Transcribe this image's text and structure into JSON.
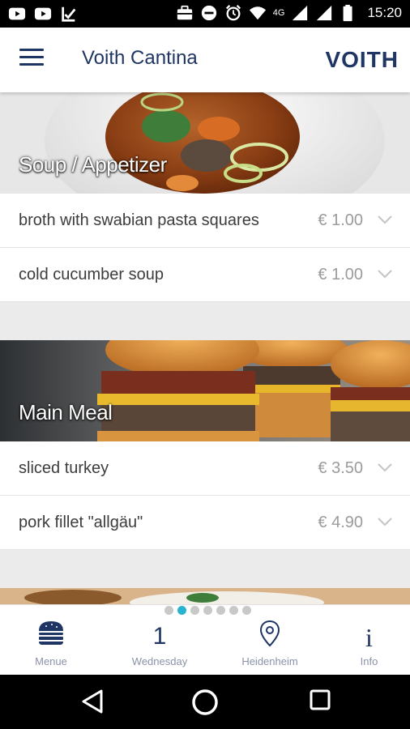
{
  "status_bar": {
    "time": "15:20",
    "network": "4G",
    "left_icons": [
      "youtube-icon",
      "youtube-icon",
      "notification-check-icon"
    ],
    "right_icons": [
      "briefcase-icon",
      "do-not-disturb-icon",
      "alarm-icon",
      "wifi-icon",
      "signal-icon",
      "signal-icon",
      "battery-icon"
    ]
  },
  "app_bar": {
    "title": "Voith Cantina",
    "brand": "VOITH",
    "menu_icon": "hamburger-menu-icon"
  },
  "sections": [
    {
      "title": "Soup / Appetizer",
      "items": [
        {
          "name": "broth with swabian pasta squares",
          "price": "€ 1.00"
        },
        {
          "name": "cold cucumber soup",
          "price": "€ 1.00"
        }
      ]
    },
    {
      "title": "Main Meal",
      "items": [
        {
          "name": "sliced turkey",
          "price": "€ 3.50"
        },
        {
          "name": "pork fillet \"allgäu\"",
          "price": "€ 4.90"
        }
      ]
    }
  ],
  "pager": {
    "count": 7,
    "active_index": 1
  },
  "bottom_nav": {
    "menue": {
      "label": "Menue",
      "icon": "burger-icon"
    },
    "day": {
      "number": "1",
      "label": "Wednesday"
    },
    "location": {
      "label": "Heidenheim",
      "icon": "location-pin-icon"
    },
    "info": {
      "glyph": "i",
      "label": "Info"
    }
  },
  "colors": {
    "brand_navy": "#1f3564",
    "accent_cyan": "#2ab3d1",
    "price_gray": "#9b9b9b"
  }
}
